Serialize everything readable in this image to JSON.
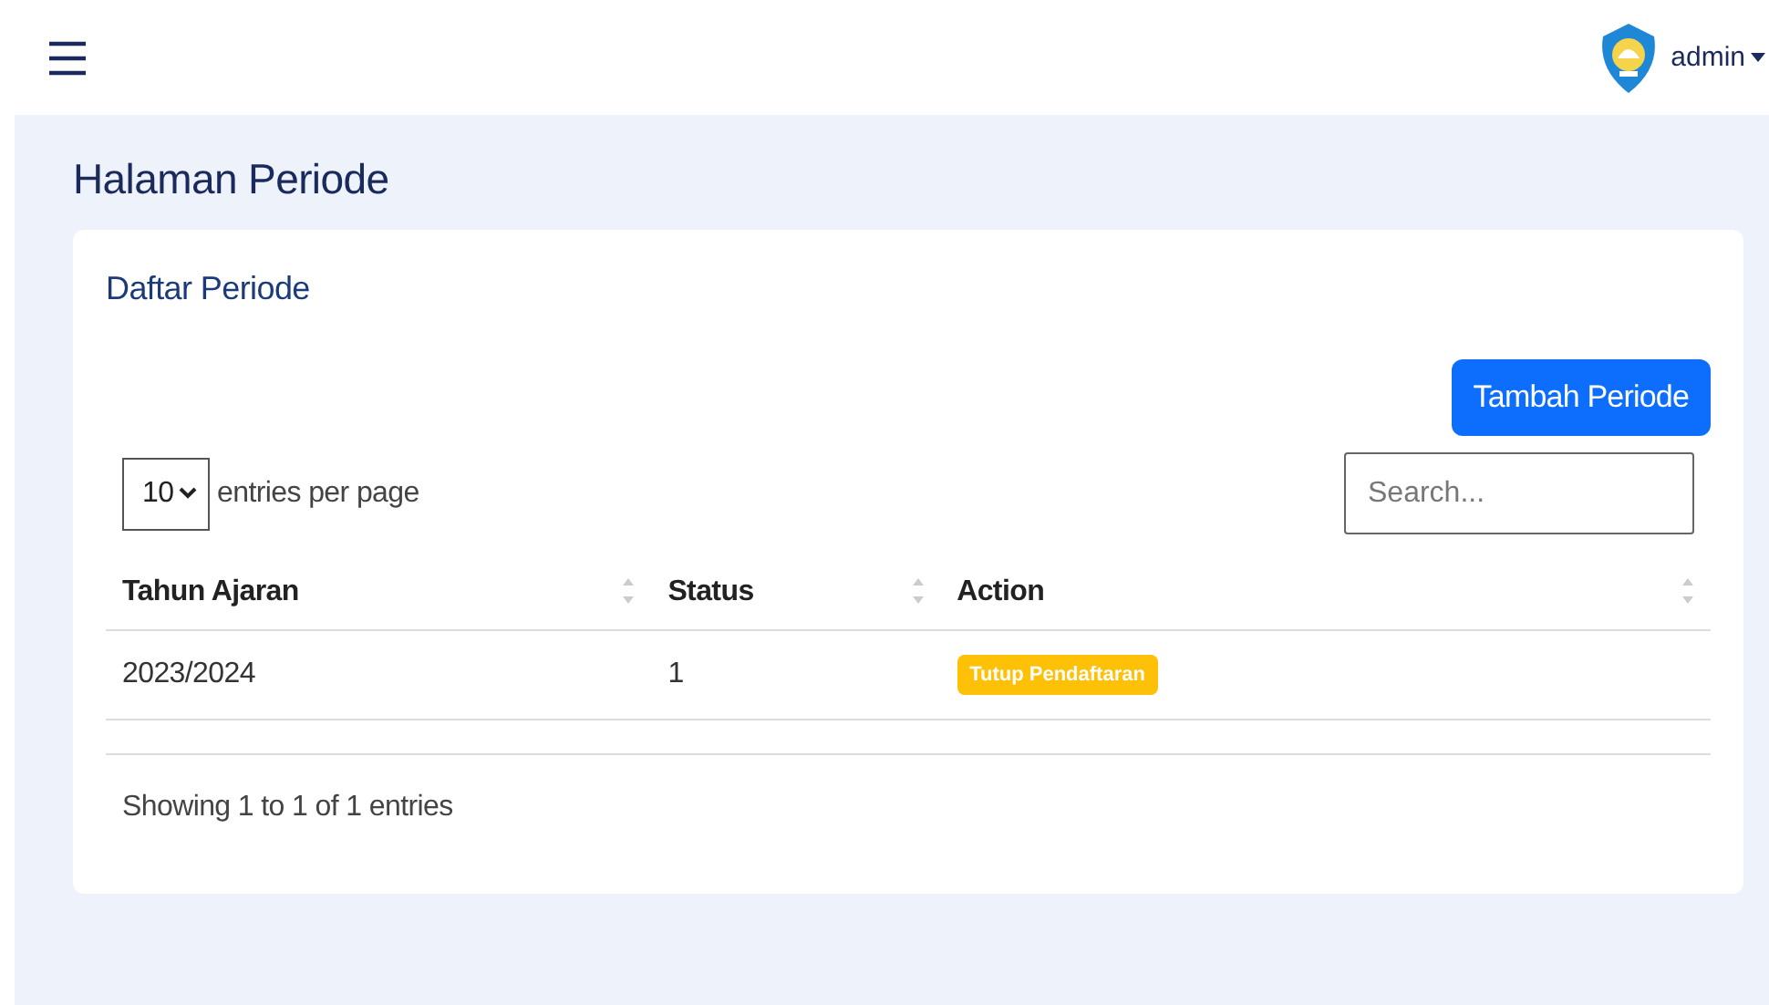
{
  "topbar": {
    "user": "admin"
  },
  "page_title": "Halaman Periode",
  "card": {
    "title": "Daftar Periode",
    "add_button": "Tambah Periode",
    "per_page": {
      "value": "10",
      "label": "entries per page"
    },
    "search": {
      "placeholder": "Search..."
    },
    "table": {
      "columns": [
        "Tahun Ajaran",
        "Status",
        "Action"
      ],
      "rows": [
        {
          "tahun_ajaran": "2023/2024",
          "status": "1",
          "action": "Tutup Pendaftaran"
        }
      ]
    },
    "info": "Showing 1 to 1 of 1 entries"
  }
}
